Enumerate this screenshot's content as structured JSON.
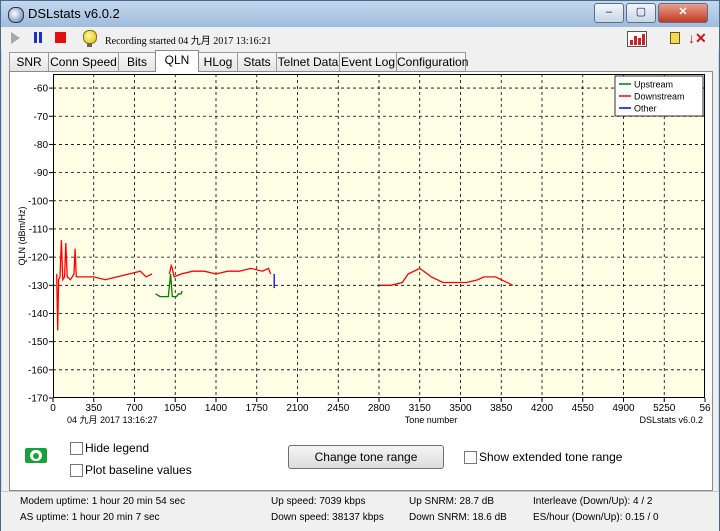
{
  "window": {
    "title": "DSLstats v6.0.2"
  },
  "toolbar": {
    "recording_status": "Recording started 04 九月 2017 13:16:21"
  },
  "tabs": [
    {
      "label": "SNR"
    },
    {
      "label": "Conn Speed"
    },
    {
      "label": "Bits"
    },
    {
      "label": "QLN",
      "active": true
    },
    {
      "label": "HLog"
    },
    {
      "label": "Stats"
    },
    {
      "label": "Telnet Data"
    },
    {
      "label": "Event Log"
    },
    {
      "label": "Configuration"
    }
  ],
  "chart_data": {
    "type": "line",
    "ylabel": "QLN (dBm/Hz)",
    "xlabel": "Tone number",
    "ylim": [
      -170,
      -55
    ],
    "xlim": [
      0,
      5600
    ],
    "yticks": [
      -60,
      -70,
      -80,
      -90,
      -100,
      -110,
      -120,
      -130,
      -140,
      -150,
      -160,
      -170
    ],
    "xtick_labels": [
      "0",
      "350",
      "700",
      "1050",
      "1400",
      "1750",
      "2100",
      "2450",
      "2800",
      "3150",
      "3500",
      "3850",
      "4200",
      "4550",
      "4900",
      "5250",
      "56"
    ],
    "footer_left": "04 九月 2017 13:16:27",
    "footer_right": "DSLstats v6.0.2",
    "grid": true,
    "legend_placement": "top-right",
    "legend": [
      {
        "name": "Upstream",
        "color": "#008000"
      },
      {
        "name": "Downstream",
        "color": "#ff0000"
      },
      {
        "name": "Other",
        "color": "#0000ff"
      }
    ],
    "series": [
      {
        "name": "Downstream",
        "color": "#ff0000",
        "segments": [
          [
            [
              32,
              -126
            ],
            [
              40,
              -146
            ],
            [
              48,
              -128
            ],
            [
              60,
              -127
            ],
            [
              72,
              -114
            ],
            [
              84,
              -128
            ],
            [
              100,
              -127
            ],
            [
              110,
              -115
            ],
            [
              122,
              -127
            ],
            [
              150,
              -128
            ],
            [
              180,
              -126
            ],
            [
              190,
              -117
            ],
            [
              200,
              -127
            ],
            [
              260,
              -127
            ],
            [
              350,
              -127
            ],
            [
              450,
              -128
            ],
            [
              550,
              -127
            ],
            [
              650,
              -126
            ],
            [
              750,
              -125
            ],
            [
              800,
              -127
            ],
            [
              850,
              -126
            ]
          ],
          [
            [
              1000,
              -126
            ],
            [
              1015,
              -123
            ],
            [
              1025,
              -124
            ],
            [
              1040,
              -127
            ],
            [
              1100,
              -126
            ],
            [
              1200,
              -125
            ],
            [
              1300,
              -125
            ],
            [
              1400,
              -126
            ],
            [
              1500,
              -125
            ],
            [
              1600,
              -125
            ],
            [
              1700,
              -124
            ],
            [
              1800,
              -125
            ],
            [
              1850,
              -124
            ],
            [
              1870,
              -126
            ]
          ],
          [
            [
              2800,
              -130
            ],
            [
              2900,
              -130
            ],
            [
              3000,
              -129
            ],
            [
              3050,
              -126
            ],
            [
              3150,
              -124
            ],
            [
              3250,
              -127
            ],
            [
              3350,
              -129
            ],
            [
              3450,
              -129
            ],
            [
              3550,
              -129
            ],
            [
              3650,
              -128
            ],
            [
              3700,
              -127
            ],
            [
              3800,
              -127
            ],
            [
              3850,
              -128
            ],
            [
              3950,
              -130
            ]
          ]
        ]
      },
      {
        "name": "Upstream",
        "color": "#008000",
        "segments": [
          [
            [
              880,
              -133
            ],
            [
              920,
              -134
            ],
            [
              960,
              -134
            ],
            [
              990,
              -134
            ],
            [
              1010,
              -126
            ],
            [
              1025,
              -134
            ],
            [
              1060,
              -134
            ],
            [
              1080,
              -133
            ],
            [
              1100,
              -133
            ],
            [
              1110,
              -132
            ]
          ]
        ]
      },
      {
        "name": "Other",
        "color": "#0000ff",
        "segments": [
          [
            [
              1900,
              -126
            ],
            [
              1900,
              -131
            ]
          ]
        ]
      }
    ]
  },
  "controls": {
    "hide_legend": "Hide legend",
    "plot_baseline": "Plot baseline values",
    "change_tone_range": "Change tone range",
    "show_extended": "Show extended tone range"
  },
  "status": {
    "modem_uptime": "Modem uptime:  1 hour 20 min 54 sec",
    "as_uptime": "AS uptime:  1 hour 20 min 7 sec",
    "up_speed": "Up speed: 7039 kbps",
    "down_speed": "Down speed: 38137 kbps",
    "up_snrm": "Up SNRM: 28.7 dB",
    "down_snrm": "Down SNRM: 18.6 dB",
    "interleave": "Interleave (Down/Up): 4 / 2",
    "es_hour": "ES/hour (Down/Up): 0.15 / 0"
  }
}
